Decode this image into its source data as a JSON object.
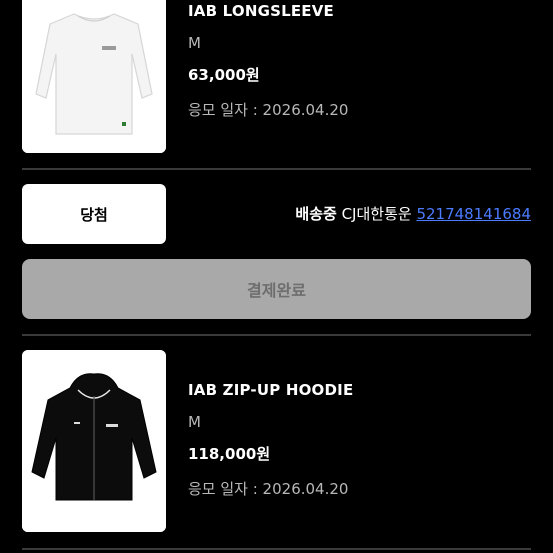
{
  "orders": [
    {
      "name": "IAB LONGSLEEVE",
      "size": "M",
      "price": "63,000원",
      "date": "응모 일자 : 2026.04.20",
      "image_icon": "white-longsleeve-shirt-icon"
    },
    {
      "name": "IAB ZIP-UP HOODIE",
      "size": "M",
      "price": "118,000원",
      "date": "응모 일자 : 2026.04.20",
      "image_icon": "black-zip-hoodie-icon"
    }
  ],
  "result": {
    "badge": "당첨",
    "status": "배송중",
    "carrier": "CJ대한통운",
    "tracking_number": "521748141684"
  },
  "payment": {
    "button_label": "결제완료"
  },
  "colors": {
    "background": "#000000",
    "card": "#ffffff",
    "link": "#4b7bff",
    "disabled_button": "#a9a9a9"
  }
}
